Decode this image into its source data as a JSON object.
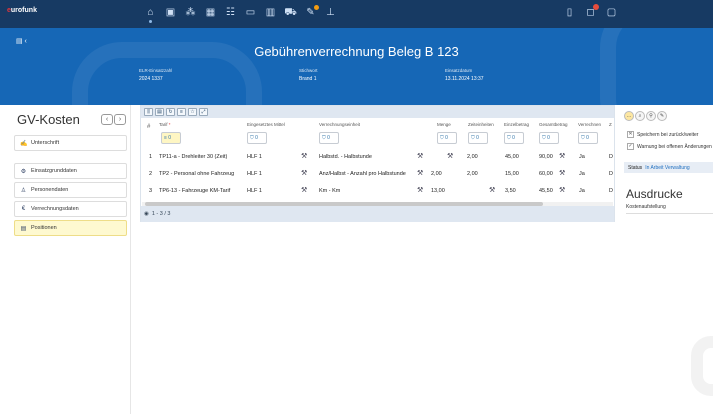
{
  "app": {
    "logo_prefix": "e",
    "logo_rest": "urofunk"
  },
  "band": {
    "title": "Gebührenverrechnung Beleg B 123",
    "meta": [
      {
        "label": "ELR-Einsatzzahl",
        "value": "2024 1337"
      },
      {
        "label": "Stichwort",
        "value": "Brand 1"
      },
      {
        "label": "Einsatzdatum",
        "value": "13.11.2024 13:37"
      }
    ]
  },
  "left": {
    "title": "GV-Kosten",
    "items": [
      {
        "icon": "signature-icon",
        "label": "Unterschrift",
        "active": false
      },
      {
        "icon": "settings-icon",
        "label": "Einsatzgrunddaten",
        "active": false
      },
      {
        "icon": "person-icon",
        "label": "Personendaten",
        "active": false
      },
      {
        "icon": "euro-icon",
        "label": "Verrechnungsdaten",
        "active": false
      },
      {
        "icon": "positions-icon",
        "label": "Positionen",
        "active": true
      }
    ]
  },
  "grid": {
    "columns": [
      "#",
      "Tarif",
      "Eingesetztes Mittel",
      "Verrechnungseinheit",
      "Menge",
      "Zeiteinheiten",
      "Einzelbetrag",
      "Gesamtbetrag",
      "Verrechnen",
      "Z"
    ],
    "rows": [
      {
        "nr": "1",
        "tarif": "TP11-a - Drehleiter 30 (Zeit)",
        "mittel": "HLF 1",
        "einheit": "Halbstd. - Halbstunde",
        "menge": "",
        "zeit": "2,00",
        "einzel": "45,00",
        "gesamt": "90,00",
        "verrechnen": "Ja",
        "z": "D"
      },
      {
        "nr": "2",
        "tarif": "TP2 - Personal ohne Fahrzeug",
        "mittel": "HLF 1",
        "einheit": "Anz/Halbst - Anzahl pro Halbstunde",
        "menge": "2,00",
        "zeit": "2,00",
        "einzel": "15,00",
        "gesamt": "60,00",
        "verrechnen": "Ja",
        "z": "D"
      },
      {
        "nr": "3",
        "tarif": "TP6-13 - Fahrzeuge KM-Tarif",
        "mittel": "HLF 1",
        "einheit": "Km - Km",
        "menge": "13,00",
        "zeit": "",
        "einzel": "3,50",
        "gesamt": "45,50",
        "verrechnen": "Ja",
        "z": "D"
      }
    ],
    "footer_count": "1 - 3 / 3"
  },
  "right": {
    "checkboxes": [
      {
        "label": "Speichern bei zurück/weiter",
        "checked": false,
        "mark": "✕"
      },
      {
        "label": "Warnung bei offenen Änderungen",
        "checked": true,
        "mark": "✓"
      }
    ],
    "status_label": "Status",
    "status_value": "In Arbeit Verwaltung",
    "print_title": "Ausdrucke",
    "print_item": "Kostenaufstellung"
  }
}
